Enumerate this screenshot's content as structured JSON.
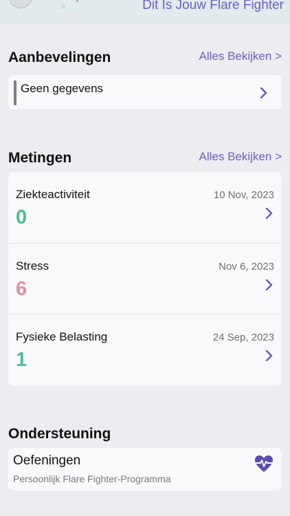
{
  "header": {
    "title": "Dit Is Jouw Flare Fighter"
  },
  "recommendations": {
    "title": "Aanbevelingen",
    "see_all": "Alles Bekijken >",
    "item": "Geen gegevens"
  },
  "metrics": {
    "title": "Metingen",
    "see_all": "Alles Bekijken >",
    "items": [
      {
        "name": "Ziekteactiviteit",
        "date": "10 Nov, 2023",
        "value": "0",
        "color": "#4dbd93"
      },
      {
        "name": "Stress",
        "date": "Nov 6, 2023",
        "value": "6",
        "color": "#e0909f"
      },
      {
        "name": "Fysieke Belasting",
        "date": "24 Sep, 2023",
        "value": "1",
        "color": "#4dbd93"
      }
    ]
  },
  "support": {
    "title": "Ondersteuning",
    "item_title": "Oefeningen",
    "item_subtitle": "Persoonlijk Flare Fighter-Programma",
    "icon": "heart-pulse-icon"
  },
  "colors": {
    "accent": "#6a5fbf",
    "green": "#4dbd93",
    "pink": "#e0909f"
  }
}
